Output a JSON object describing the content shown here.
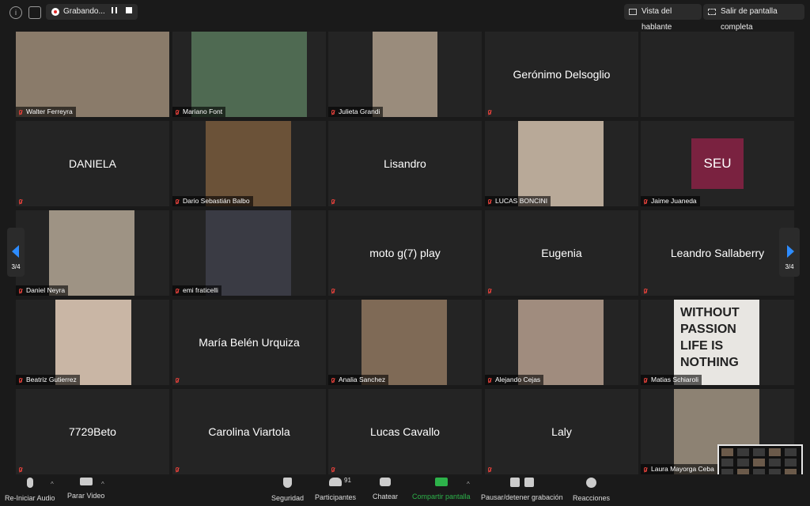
{
  "topbar": {
    "info_icon": "info-icon",
    "shield_icon": "shield-icon",
    "recording_label": "Grabando...",
    "speaker_view_label": "Vista del hablante",
    "exit_fullscreen_label": "Salir de pantalla completa"
  },
  "pager": {
    "left_label": "3/4",
    "right_label": "3/4"
  },
  "colors": {
    "muted_icon": "#e0403a",
    "seu_avatar": "#7a2240",
    "share_green": "#2db24a"
  },
  "tiles": [
    {
      "name": "Walter Ferreyra",
      "video": true
    },
    {
      "name": "Mariano Font",
      "video": true
    },
    {
      "name": "Julieta Grandi",
      "video": true
    },
    {
      "name": "Gerónimo Delsoglio",
      "video": false
    },
    {
      "name": "",
      "video": false
    },
    {
      "name": "DANIELA",
      "video": false
    },
    {
      "name": "Dario Sebastián Balbo",
      "video": true
    },
    {
      "name": "Lisandro",
      "video": false
    },
    {
      "name": "LUCAS BONCINI",
      "video": true
    },
    {
      "name": "Jaime Juaneda",
      "video": false,
      "avatar": "SEU"
    },
    {
      "name": "Daniel Neyra",
      "video": true
    },
    {
      "name": "emi fraticelli",
      "video": true
    },
    {
      "name": "moto g(7) play",
      "video": false
    },
    {
      "name": "Eugenia",
      "video": false
    },
    {
      "name": "Leandro Sallaberry",
      "video": false
    },
    {
      "name": "Beatriz Gutierrez",
      "video": true
    },
    {
      "name": "María Belén Urquiza",
      "video": false
    },
    {
      "name": "Analia Sanchez",
      "video": true
    },
    {
      "name": "Alejando Cejas",
      "video": true
    },
    {
      "name": "Matias Schiaroli",
      "video": true,
      "poster": [
        "WITHOUT",
        "PASSION",
        "LIFE IS",
        "NOTHING"
      ]
    },
    {
      "name": "7729Beto",
      "video": false
    },
    {
      "name": "Carolina Viartola",
      "video": false
    },
    {
      "name": "Lucas Cavallo",
      "video": false
    },
    {
      "name": "Laly",
      "video": false
    },
    {
      "name": "Laura Mayorga Ceba",
      "video": true
    }
  ],
  "bottombar": {
    "audio_label": "Re-Iniciar Audio",
    "video_label": "Parar Video",
    "security_label": "Seguridad",
    "participants_label": "Participantes",
    "participants_count": "91",
    "chat_label": "Chatear",
    "share_label": "Compartir pantalla",
    "recording_label": "Pausar/detener grabación",
    "reactions_label": "Reacciones"
  }
}
